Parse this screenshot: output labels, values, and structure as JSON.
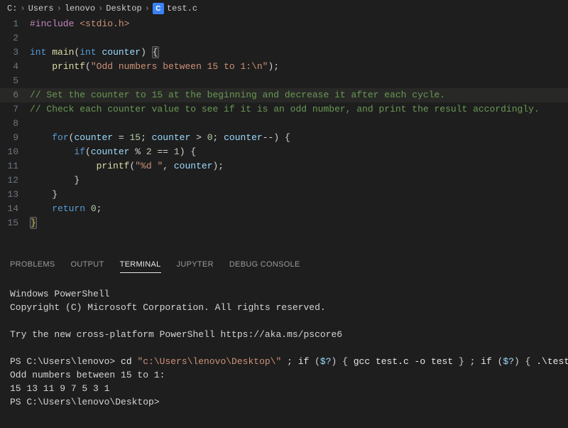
{
  "breadcrumb": {
    "parts": [
      "C:",
      "Users",
      "lenovo",
      "Desktop"
    ],
    "file_icon_letter": "C",
    "filename": "test.c"
  },
  "editor": {
    "highlight_line": 6,
    "lines": [
      {
        "n": 1,
        "segs": [
          {
            "txt": "#include",
            "cls": "tok-include"
          },
          {
            "txt": " ",
            "cls": ""
          },
          {
            "txt": "<stdio.h>",
            "cls": "tok-string"
          }
        ]
      },
      {
        "n": 2,
        "segs": [
          {
            "txt": " ",
            "cls": ""
          }
        ]
      },
      {
        "n": 3,
        "segs": [
          {
            "txt": "int",
            "cls": "tok-type"
          },
          {
            "txt": " ",
            "cls": ""
          },
          {
            "txt": "main",
            "cls": "tok-func"
          },
          {
            "txt": "(",
            "cls": "tok-brace"
          },
          {
            "txt": "int",
            "cls": "tok-type"
          },
          {
            "txt": " ",
            "cls": ""
          },
          {
            "txt": "counter",
            "cls": "tok-var"
          },
          {
            "txt": ")",
            "cls": "tok-brace"
          },
          {
            "txt": " ",
            "cls": ""
          },
          {
            "txt": "{",
            "cls": "tok-brace tok-brace-match"
          }
        ]
      },
      {
        "n": 4,
        "segs": [
          {
            "txt": "    ",
            "cls": ""
          },
          {
            "txt": "printf",
            "cls": "tok-func"
          },
          {
            "txt": "(",
            "cls": "tok-brace"
          },
          {
            "txt": "\"Odd numbers between 15 to 1:\\n\"",
            "cls": "tok-string"
          },
          {
            "txt": ");",
            "cls": "tok-brace"
          }
        ]
      },
      {
        "n": 5,
        "segs": [
          {
            "txt": " ",
            "cls": ""
          }
        ]
      },
      {
        "n": 6,
        "segs": [
          {
            "txt": "// Set the counter to 15 at the beginning and decrease it after each cycle.",
            "cls": "tok-comment"
          }
        ]
      },
      {
        "n": 7,
        "segs": [
          {
            "txt": "// Check each counter value to see if it is an odd number, and print the result accordingly.",
            "cls": "tok-comment"
          }
        ]
      },
      {
        "n": 8,
        "segs": [
          {
            "txt": " ",
            "cls": ""
          }
        ]
      },
      {
        "n": 9,
        "segs": [
          {
            "txt": "    ",
            "cls": ""
          },
          {
            "txt": "for",
            "cls": "tok-keyword"
          },
          {
            "txt": "(",
            "cls": "tok-brace"
          },
          {
            "txt": "counter",
            "cls": "tok-var"
          },
          {
            "txt": " = ",
            "cls": ""
          },
          {
            "txt": "15",
            "cls": "tok-number"
          },
          {
            "txt": "; ",
            "cls": ""
          },
          {
            "txt": "counter",
            "cls": "tok-var"
          },
          {
            "txt": " > ",
            "cls": ""
          },
          {
            "txt": "0",
            "cls": "tok-number"
          },
          {
            "txt": "; ",
            "cls": ""
          },
          {
            "txt": "counter",
            "cls": "tok-var"
          },
          {
            "txt": "--",
            "cls": ""
          },
          {
            "txt": ")",
            "cls": "tok-brace"
          },
          {
            "txt": " ",
            "cls": ""
          },
          {
            "txt": "{",
            "cls": "tok-brace"
          }
        ]
      },
      {
        "n": 10,
        "segs": [
          {
            "txt": "        ",
            "cls": ""
          },
          {
            "txt": "if",
            "cls": "tok-keyword"
          },
          {
            "txt": "(",
            "cls": "tok-brace"
          },
          {
            "txt": "counter",
            "cls": "tok-var"
          },
          {
            "txt": " % ",
            "cls": ""
          },
          {
            "txt": "2",
            "cls": "tok-number"
          },
          {
            "txt": " == ",
            "cls": ""
          },
          {
            "txt": "1",
            "cls": "tok-number"
          },
          {
            "txt": ")",
            "cls": "tok-brace"
          },
          {
            "txt": " ",
            "cls": ""
          },
          {
            "txt": "{",
            "cls": "tok-brace"
          }
        ]
      },
      {
        "n": 11,
        "segs": [
          {
            "txt": "            ",
            "cls": ""
          },
          {
            "txt": "printf",
            "cls": "tok-func"
          },
          {
            "txt": "(",
            "cls": "tok-brace"
          },
          {
            "txt": "\"%d \"",
            "cls": "tok-string"
          },
          {
            "txt": ", ",
            "cls": ""
          },
          {
            "txt": "counter",
            "cls": "tok-var"
          },
          {
            "txt": ");",
            "cls": "tok-brace"
          }
        ]
      },
      {
        "n": 12,
        "segs": [
          {
            "txt": "        ",
            "cls": ""
          },
          {
            "txt": "}",
            "cls": "tok-brace"
          }
        ]
      },
      {
        "n": 13,
        "segs": [
          {
            "txt": "    ",
            "cls": ""
          },
          {
            "txt": "}",
            "cls": "tok-brace"
          }
        ]
      },
      {
        "n": 14,
        "segs": [
          {
            "txt": "    ",
            "cls": ""
          },
          {
            "txt": "return",
            "cls": "tok-keyword"
          },
          {
            "txt": " ",
            "cls": ""
          },
          {
            "txt": "0",
            "cls": "tok-number"
          },
          {
            "txt": ";",
            "cls": "tok-brace"
          }
        ]
      },
      {
        "n": 15,
        "segs": [
          {
            "txt": "}",
            "cls": "tok-yellow tok-brace-match"
          }
        ]
      }
    ]
  },
  "panel": {
    "tabs": [
      {
        "label": "PROBLEMS",
        "active": false
      },
      {
        "label": "OUTPUT",
        "active": false
      },
      {
        "label": "TERMINAL",
        "active": true
      },
      {
        "label": "JUPYTER",
        "active": false
      },
      {
        "label": "DEBUG CONSOLE",
        "active": false
      }
    ]
  },
  "terminal": {
    "lines": [
      [
        {
          "txt": "Windows PowerShell",
          "cls": ""
        }
      ],
      [
        {
          "txt": "Copyright (C) Microsoft Corporation. All rights reserved.",
          "cls": ""
        }
      ],
      [
        {
          "txt": " ",
          "cls": ""
        }
      ],
      [
        {
          "txt": "Try the new cross-platform PowerShell https://aka.ms/pscore6",
          "cls": ""
        }
      ],
      [
        {
          "txt": " ",
          "cls": ""
        }
      ],
      [
        {
          "txt": "PS C:\\Users\\lenovo> ",
          "cls": "ps-path"
        },
        {
          "txt": "cd ",
          "cls": "ps-cmd"
        },
        {
          "txt": "\"c:\\Users\\lenovo\\Desktop\\\"",
          "cls": "ps-string"
        },
        {
          "txt": " ; ",
          "cls": ""
        },
        {
          "txt": "if",
          "cls": "ps-cmd"
        },
        {
          "txt": " (",
          "cls": ""
        },
        {
          "txt": "$?",
          "cls": "ps-autovar"
        },
        {
          "txt": ") { ",
          "cls": ""
        },
        {
          "txt": "gcc test.c -o test",
          "cls": "ps-cmd"
        },
        {
          "txt": " } ; ",
          "cls": ""
        },
        {
          "txt": "if",
          "cls": "ps-cmd"
        },
        {
          "txt": " (",
          "cls": ""
        },
        {
          "txt": "$?",
          "cls": "ps-autovar"
        },
        {
          "txt": ") { ",
          "cls": ""
        },
        {
          "txt": ".\\test",
          "cls": "ps-cmd"
        },
        {
          "txt": " }",
          "cls": ""
        }
      ],
      [
        {
          "txt": "Odd numbers between 15 to 1:",
          "cls": ""
        }
      ],
      [
        {
          "txt": "15 13 11 9 7 5 3 1",
          "cls": ""
        }
      ],
      [
        {
          "txt": "PS C:\\Users\\lenovo\\Desktop> ",
          "cls": "ps-path"
        }
      ]
    ]
  }
}
